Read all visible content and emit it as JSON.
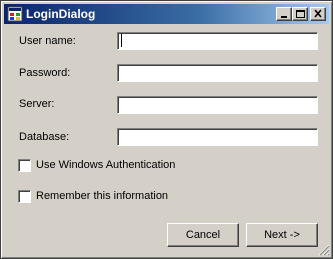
{
  "window": {
    "title": "LoginDialog"
  },
  "fields": {
    "user_name": {
      "label": "User name:",
      "value": ""
    },
    "password": {
      "label": "Password:",
      "value": ""
    },
    "server": {
      "label": "Server:",
      "value": ""
    },
    "database": {
      "label": "Database:",
      "value": ""
    }
  },
  "options": {
    "use_windows_auth": {
      "label": "Use Windows Authentication",
      "checked": false
    },
    "remember_info": {
      "label": "Remember this information",
      "checked": false
    }
  },
  "buttons": {
    "cancel": "Cancel",
    "next": "Next ->"
  },
  "icons": {
    "app": "app-window-icon",
    "minimize": "minimize-icon",
    "maximize": "maximize-icon",
    "close": "close-icon",
    "grip": "resize-grip-icon"
  },
  "colors": {
    "face": "#d4d0c8",
    "title_start": "#0a246a",
    "title_end": "#a6caf0",
    "title_text": "#ffffff"
  }
}
